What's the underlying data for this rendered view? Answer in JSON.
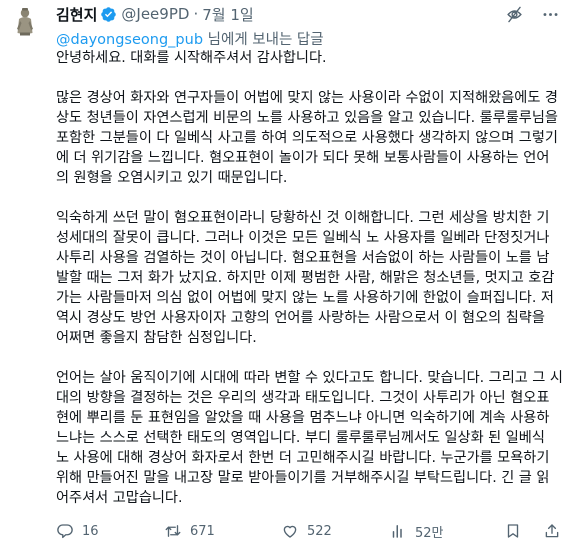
{
  "author": {
    "name": "김현지",
    "handle": "@Jee9PD",
    "separator": "·",
    "date": "7월 1일"
  },
  "reply_context": {
    "mention": "@dayongseong_pub",
    "suffix": " 님에게 보내는 답글"
  },
  "tweet": {
    "paragraphs": [
      {
        "lines": [
          "안녕하세요. 대화를 시작해주셔서 감사합니다."
        ]
      },
      {
        "lines": [
          "많은 경상어 화자와 연구자들이 어법에 맞지 않는 사용이라 수없이 지적해왔음에도 경",
          "상도 청년들이 자연스럽게 비문의 노를 사용하고 있음을 알고 있습니다. 룰루룰루님을",
          "포함한 그분들이 다 일베식 사고를 하여 의도적으로 사용했다 생각하지 않으며 그렇기",
          "에 더 위기감을 느낍니다. 혐오표현이 놀이가 되다 못해 보통사람들이 사용하는 언어",
          "의 원형을 오염시키고 있기 때문입니다."
        ]
      },
      {
        "lines": [
          "익숙하게 쓰던 말이 혐오표현이라니 당황하신 것 이해합니다. 그런 세상을 방치한 기",
          "성세대의 잘못이 큽니다. 그러나 이것은 모든 일베식 노 사용자를 일베라 단정짓거나",
          "사투리 사용을 검열하는 것이 아닙니다. 혐오표현을 서슴없이 하는 사람들이 노를 남",
          "발할 때는 그저 화가 났지요. 하지만 이제 평범한 사람, 해맑은 청소년들, 멋지고 호감",
          "가는 사람들마저 의심 없이 어법에 맞지 않는 노를 사용하기에 한없이 슬퍼집니다. 저",
          "역시 경상도 방언 사용자이자 고향의 언어를 사랑하는 사람으로서 이 혐오의 침략을",
          "어쩌면 좋을지 참담한 심정입니다."
        ]
      },
      {
        "lines": [
          "언어는 살아 움직이기에 시대에 따라 변할 수 있다고도 합니다. 맞습니다. 그리고 그 시",
          "대의 방향을 결정하는 것은 우리의 생각과 태도입니다. 그것이 사투리가 아닌 혐오표",
          "현에 뿌리를 둔 표현임을 알았을 때 사용을 멈추느냐 아니면 익숙하기에 계속 사용하",
          "느냐는 스스로 선택한 태도의 영역입니다. 부디 룰루룰루님께서도 일상화 된 일베식",
          "노 사용에 대해 경상어 화자로서 한번 더 고민해주시길 바랍니다. 누군가를 모욕하기",
          "위해 만들어진 말을 내고장 말로 받아들이기를 거부해주시길 부탁드립니다. 긴 글 읽",
          "어주셔서 고맙습니다."
        ]
      }
    ]
  },
  "actions": {
    "replies": "16",
    "reposts": "671",
    "likes": "522",
    "views": "52만"
  },
  "icons": {
    "verified": "verified-badge-icon",
    "hide": "eye-slash-icon",
    "more": "more-dots-icon",
    "reply": "comment-icon",
    "repost": "repost-icon",
    "like": "heart-icon",
    "views": "analytics-icon",
    "bookmark": "bookmark-icon",
    "share": "share-icon"
  },
  "colors": {
    "text": "#0f1419",
    "secondary": "#536471",
    "accent": "#1d9bf0"
  }
}
